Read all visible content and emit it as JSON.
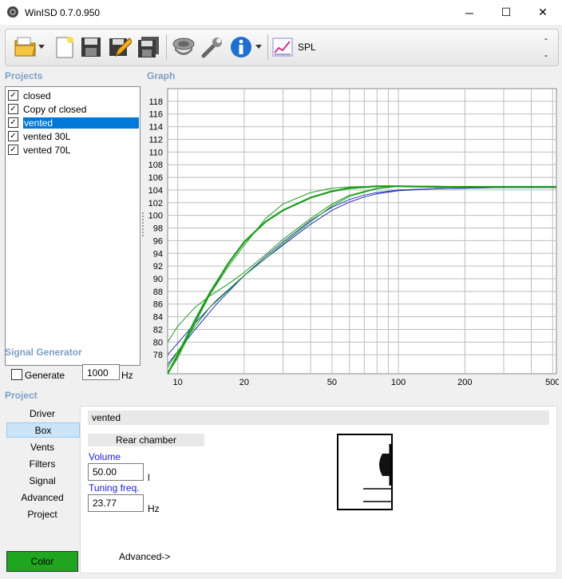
{
  "window": {
    "title": "WinISD 0.7.0.950",
    "minimize": "─",
    "maximize": "☐",
    "close": "✕"
  },
  "toolbar": {
    "spl_label": "SPL",
    "dash1": "-",
    "dash2": "-"
  },
  "projects": {
    "heading": "Projects",
    "items": [
      {
        "label": "closed",
        "checked": true,
        "selected": false
      },
      {
        "label": "Copy of closed",
        "checked": true,
        "selected": false
      },
      {
        "label": "vented",
        "checked": true,
        "selected": true
      },
      {
        "label": "vented 30L",
        "checked": true,
        "selected": false
      },
      {
        "label": "vented 70L",
        "checked": true,
        "selected": false
      }
    ],
    "check_glyph": "✓"
  },
  "graph": {
    "heading": "Graph"
  },
  "chart_data": {
    "type": "line",
    "xscale": "log",
    "xlim": [
      9,
      520
    ],
    "ylim": [
      75,
      120
    ],
    "yticks": [
      78,
      80,
      82,
      84,
      86,
      88,
      90,
      92,
      94,
      96,
      98,
      100,
      102,
      104,
      106,
      108,
      110,
      112,
      114,
      116,
      118
    ],
    "xticks": [
      10,
      20,
      50,
      100,
      200,
      500
    ],
    "grid": true,
    "series": [
      {
        "color": "#1f2fb5",
        "x": [
          9,
          12,
          15,
          20,
          25,
          30,
          40,
          50,
          60,
          70,
          80,
          100,
          150,
          200,
          300,
          520
        ],
        "y": [
          76.5,
          82,
          86,
          90.5,
          93.5,
          95.8,
          99.2,
          101.3,
          102.5,
          103.2,
          103.6,
          104,
          104.2,
          104.3,
          104.4,
          104.4
        ]
      },
      {
        "color": "#1f2fb5",
        "x": [
          9,
          12,
          15,
          20,
          25,
          30,
          40,
          50,
          60,
          70,
          80,
          100,
          150,
          200,
          300,
          520
        ],
        "y": [
          78,
          83,
          86.6,
          90.5,
          93.2,
          95.3,
          98.6,
          100.8,
          102.1,
          102.9,
          103.4,
          103.9,
          104.2,
          104.3,
          104.4,
          104.4
        ]
      },
      {
        "color": "#1a9a1a",
        "x": [
          9,
          10,
          12,
          14,
          17,
          20,
          25,
          30,
          40,
          50,
          60,
          80,
          100,
          150,
          200,
          300,
          520
        ],
        "y": [
          75,
          78,
          83.5,
          87.8,
          92.5,
          95.8,
          99,
          100.8,
          102.8,
          103.8,
          104.3,
          104.6,
          104.6,
          104.5,
          104.5,
          104.5,
          104.5
        ]
      },
      {
        "color": "#1a9a1a",
        "x": [
          9,
          10,
          12,
          14,
          17,
          20,
          25,
          30,
          40,
          50,
          60,
          80,
          100,
          150,
          200,
          300,
          520
        ],
        "y": [
          75,
          77.5,
          83,
          87.5,
          92,
          95.3,
          99.5,
          101.8,
          103.6,
          104.3,
          104.5,
          104.6,
          104.6,
          104.5,
          104.5,
          104.5,
          104.5
        ]
      },
      {
        "color": "#1a9a1a",
        "x": [
          9,
          10,
          12,
          14,
          17,
          20,
          25,
          30,
          40,
          50,
          60,
          80,
          100,
          150,
          200,
          300,
          520
        ],
        "y": [
          80,
          82.5,
          85.5,
          87.3,
          89.2,
          91,
          93.8,
          96.2,
          99.5,
          101.8,
          103.2,
          104.3,
          104.6,
          104.6,
          104.5,
          104.5,
          104.5
        ]
      },
      {
        "color": "#1a9a1a",
        "x": [
          9,
          10,
          12,
          14,
          17,
          20,
          25,
          30,
          40,
          50,
          60,
          80,
          100,
          150,
          200,
          300,
          520
        ],
        "y": [
          76,
          78.5,
          82.5,
          85.5,
          88.2,
          90.5,
          93.2,
          95.5,
          99,
          101.5,
          103,
          104.2,
          104.6,
          104.6,
          104.5,
          104.5,
          104.5
        ]
      }
    ]
  },
  "signal": {
    "heading": "Signal Generator",
    "generate_label": "Generate",
    "freq": "1000",
    "unit": "Hz"
  },
  "project": {
    "heading": "Project",
    "nav": [
      "Driver",
      "Box",
      "Vents",
      "Filters",
      "Signal",
      "Advanced",
      "Project"
    ],
    "selected_nav": "Box",
    "color_button": "Color",
    "color_value": "#1fa51f",
    "name": "vented",
    "rear_chamber": "Rear chamber",
    "volume_label": "Volume",
    "volume_value": "50.00",
    "volume_unit": "l",
    "tuning_label": "Tuning freq.",
    "tuning_value": "23.77",
    "tuning_unit": "Hz",
    "advanced_link": "Advanced->"
  }
}
